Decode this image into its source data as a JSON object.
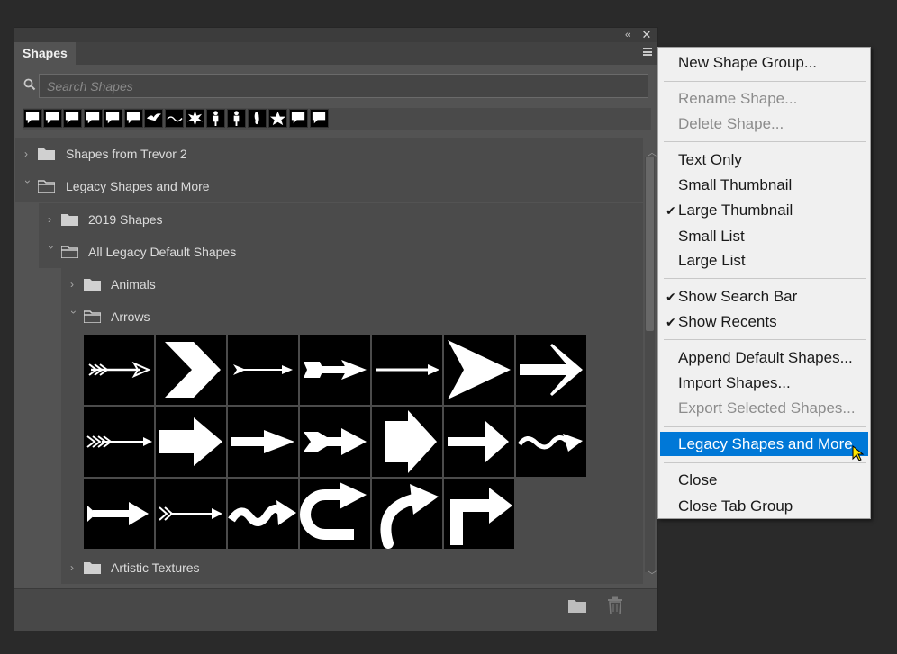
{
  "panel": {
    "tab_label": "Shapes",
    "search_placeholder": "Search Shapes"
  },
  "recent_shapes": [
    "speech-bubble",
    "speech-bubble",
    "speech-bubble",
    "speech-bubble",
    "speech-bubble",
    "speech-bubble",
    "bird",
    "wave",
    "burst",
    "person",
    "person",
    "foot",
    "star",
    "speech-bubble",
    "speech-bubble"
  ],
  "tree": [
    {
      "label": "Shapes from Trevor 2",
      "expanded": false
    },
    {
      "label": "Legacy Shapes and More",
      "expanded": true
    },
    {
      "label": "2019 Shapes",
      "expanded": false
    },
    {
      "label": "All Legacy Default Shapes",
      "expanded": true
    },
    {
      "label": "Animals",
      "expanded": false
    },
    {
      "label": "Arrows",
      "expanded": true
    },
    {
      "label": "Artistic Textures",
      "expanded": false
    }
  ],
  "arrow_shapes": [
    "fletched-arrow",
    "chevron",
    "thin-arrow",
    "double-head-arrow",
    "line-arrow",
    "triangle-arrow",
    "bold-arrow",
    "feathered-arrow",
    "block-arrow",
    "tapered-arrow",
    "notched-arrow",
    "pentagon-arrow",
    "block-arrow-2",
    "wavy-arrow",
    "simple-arrow",
    "fletched-thin-arrow",
    "squiggle-arrow",
    "u-turn-arrow",
    "curved-arrow",
    "corner-arrow"
  ],
  "menu": {
    "items": [
      {
        "label": "New Shape Group...",
        "disabled": false,
        "checked": false
      },
      {
        "label": "Rename Shape...",
        "disabled": true,
        "checked": false
      },
      {
        "label": "Delete Shape...",
        "disabled": true,
        "checked": false
      },
      {
        "label": "Text Only",
        "disabled": false,
        "checked": false
      },
      {
        "label": "Small Thumbnail",
        "disabled": false,
        "checked": false
      },
      {
        "label": "Large Thumbnail",
        "disabled": false,
        "checked": true
      },
      {
        "label": "Small List",
        "disabled": false,
        "checked": false
      },
      {
        "label": "Large List",
        "disabled": false,
        "checked": false
      },
      {
        "label": "Show Search Bar",
        "disabled": false,
        "checked": true
      },
      {
        "label": "Show Recents",
        "disabled": false,
        "checked": true
      },
      {
        "label": "Append Default Shapes...",
        "disabled": false,
        "checked": false
      },
      {
        "label": "Import Shapes...",
        "disabled": false,
        "checked": false
      },
      {
        "label": "Export Selected Shapes...",
        "disabled": true,
        "checked": false
      },
      {
        "label": "Legacy Shapes and More",
        "disabled": false,
        "checked": false,
        "highlighted": true
      },
      {
        "label": "Close",
        "disabled": false,
        "checked": false
      },
      {
        "label": "Close Tab Group",
        "disabled": false,
        "checked": false
      }
    ],
    "check_glyph": "✔",
    "highlight_color": "#0078d7"
  }
}
